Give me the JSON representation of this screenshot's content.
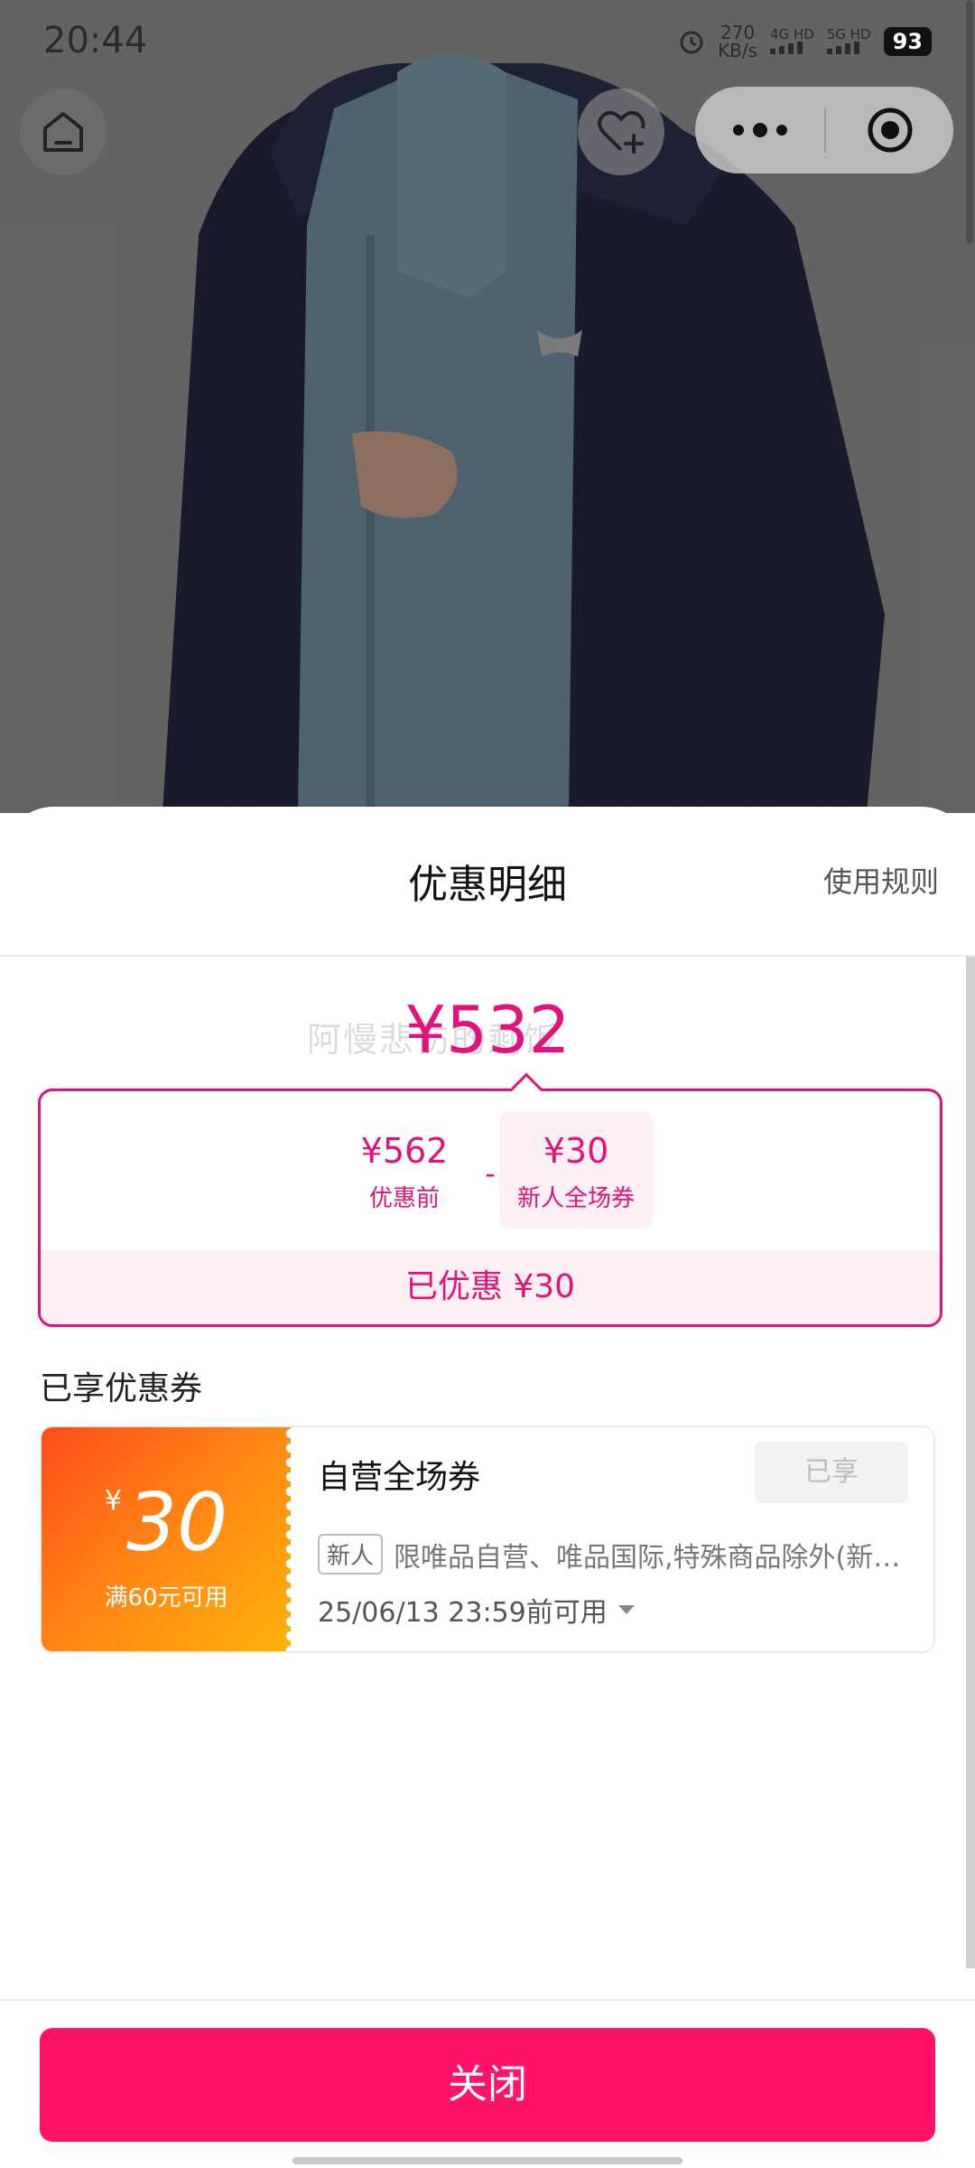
{
  "status_bar": {
    "time": "20:44",
    "speed_value": "270",
    "speed_unit": "KB/s",
    "net_1": "4G HD",
    "net_2": "5G HD",
    "battery": "93",
    "alarm_icon": "alarm-icon"
  },
  "nav": {
    "home_icon": "home-icon",
    "favorite_icon": "heart-plus-icon",
    "more_icon": "more-dots-icon",
    "close_miniapp_icon": "target-circle-icon"
  },
  "sheet": {
    "title": "优惠明细",
    "rules_link": "使用规则",
    "watermark": "阿慢悲伤的剩饭",
    "final_price": "¥532",
    "calc": {
      "original_amount": "¥562",
      "original_label": "优惠前",
      "minus": "-",
      "coupon_amount": "¥30",
      "coupon_label": "新人全场券",
      "saved_text": "已优惠 ¥30"
    },
    "section_title": "已享优惠券",
    "coupon": {
      "yen": "¥",
      "amount": "30",
      "condition": "满60元可用",
      "name": "自营全场券",
      "status": "已享",
      "tag": "新人",
      "description": "限唯品自营、唯品国际,特殊商品除外(新…",
      "expiry": "25/06/13 23:59前可用"
    },
    "close_button": "关闭"
  },
  "colors": {
    "accent": "#e2127a",
    "button": "#ff1366",
    "coupon_gradient_start": "#ff4d1a",
    "coupon_gradient_end": "#ffb30a"
  }
}
